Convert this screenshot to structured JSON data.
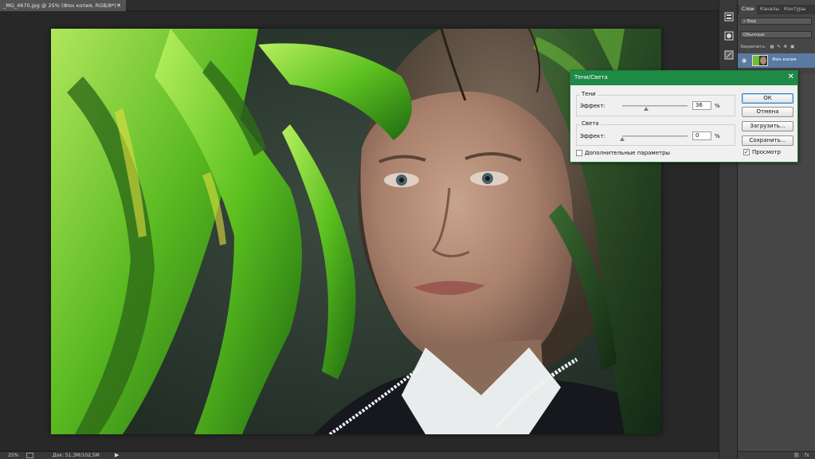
{
  "document": {
    "tab_title": "_MG_4670.jpg @ 25% (Фон копия, RGB/8*) *",
    "close_glyph": "×"
  },
  "status_bar": {
    "zoom": "25%",
    "doc_size": "Док: 51,3M/102,5M",
    "arrow_glyph": "▶"
  },
  "tools": [
    {
      "name": "history-icon"
    },
    {
      "name": "adjustments-icon"
    },
    {
      "name": "properties-icon"
    },
    {
      "name": "brush-presets-icon"
    }
  ],
  "layers_panel": {
    "tabs": [
      "Слои",
      "Каналы",
      "Контуры"
    ],
    "active_tab": "Слои",
    "kind_filter": "Вид",
    "blend_mode": "Обычные",
    "lock_label": "Закрепить:",
    "layer_name": "Фон копия",
    "eye_glyph": "◉",
    "fx_glyph": "fx"
  },
  "dialog": {
    "title": "Тени/Света",
    "close_glyph": "✕",
    "shadows": {
      "group_label": "Тени",
      "amount_label": "Эффект:",
      "amount_value": "36",
      "amount_fraction": 0.36,
      "percent": "%"
    },
    "highlights": {
      "group_label": "Света",
      "amount_label": "Эффект:",
      "amount_value": "0",
      "amount_fraction": 0.0,
      "percent": "%"
    },
    "show_more_options": {
      "label": "Дополнительные параметры",
      "checked": false
    },
    "preview": {
      "label": "Просмотр",
      "checked": true,
      "check_glyph": "✓"
    },
    "buttons": {
      "ok": "ОК",
      "cancel": "Отмена",
      "load": "Загрузить...",
      "save": "Сохранить..."
    }
  },
  "colors": {
    "dialog_titlebar": "#1f8a45",
    "selected_layer": "#5b7aa3",
    "workspace": "#282828"
  }
}
